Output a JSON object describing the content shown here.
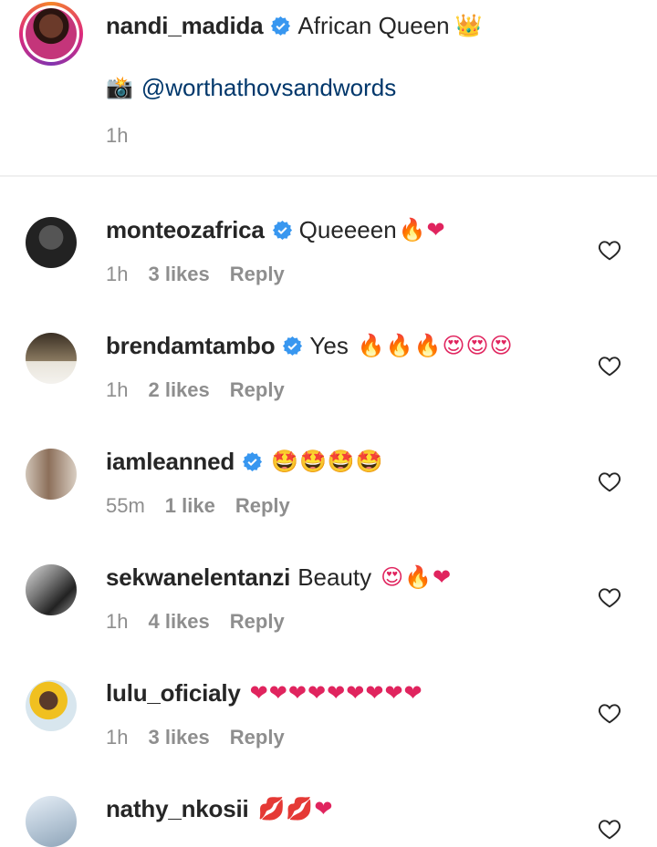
{
  "caption": {
    "username": "nandi_madida",
    "text": "African Queen",
    "text_emoji": "👑",
    "camera_emoji": "📸",
    "mention": "@worthathovsandwords",
    "time": "1h"
  },
  "comments": [
    {
      "username": "monteozafrica",
      "verified": true,
      "text": "Queeeen",
      "emoji": "🔥❤",
      "time": "1h",
      "likes": "3 likes",
      "reply": "Reply"
    },
    {
      "username": "brendamtambo",
      "verified": true,
      "text": "Yes",
      "emoji": "🔥🔥🔥😍😍😍",
      "time": "1h",
      "likes": "2 likes",
      "reply": "Reply"
    },
    {
      "username": "iamleanned",
      "verified": true,
      "text": "",
      "emoji": "🤩🤩🤩🤩",
      "time": "55m",
      "likes": "1 like",
      "reply": "Reply"
    },
    {
      "username": "sekwanelentanzi",
      "verified": false,
      "text": "Beauty",
      "emoji": "😍🔥❤",
      "time": "1h",
      "likes": "4 likes",
      "reply": "Reply"
    },
    {
      "username": "lulu_oficialy",
      "verified": false,
      "text": "",
      "emoji": "❤❤❤❤❤❤❤❤❤",
      "time": "1h",
      "likes": "3 likes",
      "reply": "Reply"
    },
    {
      "username": "nathy_nkosii",
      "verified": false,
      "text": "",
      "emoji": "💋💋❤",
      "time": "",
      "likes": "",
      "reply": ""
    }
  ],
  "colors": {
    "verified": "#3897f0",
    "link": "#00376b",
    "meta": "#8e8e8e"
  }
}
